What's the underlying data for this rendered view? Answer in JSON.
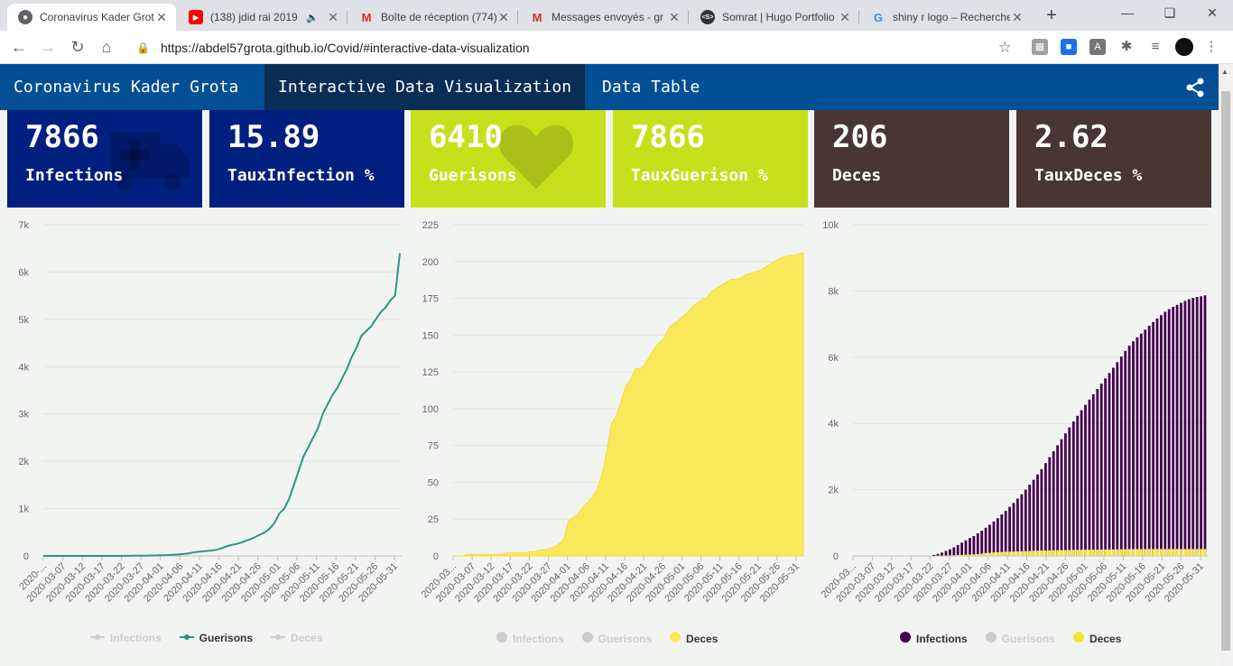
{
  "browser": {
    "tabs": [
      {
        "title": "Coronavirus Kader Grota",
        "favicon": "globe-icon",
        "active": true
      },
      {
        "title": "(138) jdid rai 2019",
        "favicon": "youtube-icon",
        "active": false,
        "audio": true
      },
      {
        "title": "Boîte de réception (774)",
        "favicon": "gmail-icon",
        "active": false
      },
      {
        "title": "Messages envoyés - gr",
        "favicon": "gmail-icon",
        "active": false
      },
      {
        "title": "Somrat | Hugo Portfolio",
        "favicon": "hugo-icon",
        "active": false
      },
      {
        "title": "shiny r logo – Recherche",
        "favicon": "google-icon",
        "active": false
      }
    ],
    "url": "https://abdel57grota.github.io/Covid/#interactive-data-visualization"
  },
  "app": {
    "brand": "Coronavirus Kader Grota",
    "nav": [
      {
        "label": "Interactive Data Visualization",
        "active": true
      },
      {
        "label": "Data Table",
        "active": false
      }
    ]
  },
  "value_boxes": [
    {
      "value": "7866",
      "label": "Infections",
      "color": "#001f7f",
      "icon": "ambulance-icon"
    },
    {
      "value": "15.89",
      "label": "TauxInfection %",
      "color": "#001f7f",
      "icon": ""
    },
    {
      "value": "6410",
      "label": "Guerisons",
      "color": "#c6e01c",
      "icon": "heart-icon"
    },
    {
      "value": "7866",
      "label": "TauxGuerison %",
      "color": "#c6e01c",
      "icon": ""
    },
    {
      "value": "206",
      "label": "Deces",
      "color": "#4a3535",
      "icon": ""
    },
    {
      "value": "2.62",
      "label": "TauxDeces %",
      "color": "#4a3535",
      "icon": ""
    }
  ],
  "colors": {
    "nav": "#024f96",
    "nav_active": "#0a2d55",
    "guerisons_line": "#2a958a",
    "deces_area": "#f9e95a",
    "infections_bar": "#44004f",
    "deces_bar": "#f5e530",
    "legend_inactive": "#cccccc"
  },
  "chart_data": [
    {
      "type": "line",
      "x_tick_labels": [
        "2020-...",
        "2020-03-07",
        "2020-03-12",
        "2020-03-17",
        "2020-03-22",
        "2020-03-27",
        "2020-04-01",
        "2020-04-06",
        "2020-04-11",
        "2020-04-16",
        "2020-04-21",
        "2020-04-26",
        "2020-05-01",
        "2020-05-06",
        "2020-05-11",
        "2020-05-16",
        "2020-05-21",
        "2020-05-26",
        "2020-05-31"
      ],
      "y_tick_labels": [
        "0",
        "1k",
        "2k",
        "3k",
        "4k",
        "5k",
        "6k",
        "7k"
      ],
      "ylim": [
        0,
        7000
      ],
      "days": 89,
      "series": [
        {
          "name": "Infections",
          "visible": false
        },
        {
          "name": "Guerisons",
          "visible": true,
          "values": [
            0,
            0,
            0,
            0,
            0,
            0,
            0,
            0,
            0,
            0,
            0,
            0,
            0,
            0,
            0,
            0,
            0,
            1,
            2,
            3,
            4,
            5,
            7,
            9,
            12,
            16,
            20,
            25,
            30,
            40,
            50,
            70,
            85,
            95,
            105,
            115,
            130,
            160,
            200,
            230,
            250,
            280,
            320,
            350,
            400,
            450,
            500,
            580,
            700,
            900,
            1000,
            1200,
            1500,
            1800,
            2100,
            2300,
            2500,
            2700,
            3000,
            3200,
            3400,
            3550,
            3750,
            3950,
            4200,
            4400,
            4650,
            4750,
            4850,
            5000,
            5150,
            5250,
            5400,
            5500,
            6400
          ]
        },
        {
          "name": "Deces",
          "visible": false
        }
      ]
    },
    {
      "type": "area",
      "x_tick_labels": [
        "2020-03...",
        "2020-03-07",
        "2020-03-12",
        "2020-03-17",
        "2020-03-22",
        "2020-03-27",
        "2020-04-01",
        "2020-04-06",
        "2020-04-11",
        "2020-04-16",
        "2020-04-21",
        "2020-04-26",
        "2020-05-01",
        "2020-05-06",
        "2020-05-11",
        "2020-05-16",
        "2020-05-21",
        "2020-05-26",
        "2020-05-31"
      ],
      "y_tick_labels": [
        "0",
        "25",
        "50",
        "75",
        "100",
        "125",
        "150",
        "175",
        "200",
        "225"
      ],
      "ylim": [
        0,
        225
      ],
      "series": [
        {
          "name": "Infections",
          "visible": false
        },
        {
          "name": "Guerisons",
          "visible": false
        },
        {
          "name": "Deces",
          "visible": true,
          "values": [
            0,
            0,
            0,
            1,
            1,
            1,
            1,
            1,
            1,
            1,
            1,
            2,
            2,
            2,
            2,
            2,
            3,
            3,
            4,
            4,
            5,
            6,
            8,
            11,
            24,
            26,
            28,
            33,
            36,
            40,
            45,
            55,
            70,
            90,
            95,
            105,
            115,
            120,
            127,
            127,
            130,
            136,
            141,
            145,
            148,
            155,
            158,
            160,
            163,
            166,
            170,
            172,
            174,
            176,
            180,
            182,
            184,
            186,
            188,
            188,
            189,
            191,
            192,
            193,
            194,
            196,
            198,
            200,
            202,
            203,
            204,
            204,
            205,
            206
          ]
        }
      ]
    },
    {
      "type": "bar",
      "x_tick_labels": [
        "2020-03...",
        "2020-03-07",
        "2020-03-12",
        "2020-03-17",
        "2020-03-22",
        "2020-03-27",
        "2020-04-01",
        "2020-04-06",
        "2020-04-11",
        "2020-04-16",
        "2020-04-21",
        "2020-04-26",
        "2020-05-01",
        "2020-05-06",
        "2020-05-11",
        "2020-05-16",
        "2020-05-21",
        "2020-05-26",
        "2020-05-31"
      ],
      "y_tick_labels": [
        "0",
        "2k",
        "4k",
        "6k",
        "8k",
        "10k"
      ],
      "ylim": [
        0,
        10000
      ],
      "series": [
        {
          "name": "Infections",
          "visible": true,
          "values": [
            0,
            0,
            0,
            0,
            0,
            0,
            0,
            0,
            0,
            0,
            0,
            0,
            0,
            0,
            0,
            0,
            0,
            0,
            0,
            0,
            30,
            60,
            100,
            150,
            200,
            260,
            330,
            400,
            470,
            540,
            600,
            680,
            760,
            850,
            940,
            1040,
            1140,
            1250,
            1360,
            1480,
            1600,
            1730,
            1860,
            2000,
            2150,
            2300,
            2460,
            2620,
            2800,
            2980,
            3160,
            3340,
            3520,
            3700,
            3880,
            4060,
            4230,
            4400,
            4560,
            4720,
            4880,
            5040,
            5200,
            5360,
            5520,
            5680,
            5850,
            6020,
            6190,
            6350,
            6480,
            6600,
            6710,
            6830,
            6950,
            7060,
            7170,
            7270,
            7370,
            7450,
            7520,
            7580,
            7640,
            7700,
            7750,
            7790,
            7820,
            7840,
            7866
          ]
        },
        {
          "name": "Guerisons",
          "visible": false
        },
        {
          "name": "Deces",
          "visible": true,
          "values": [
            0,
            0,
            0,
            0,
            0,
            0,
            0,
            0,
            0,
            0,
            0,
            0,
            0,
            0,
            0,
            0,
            0,
            0,
            0,
            0,
            3,
            5,
            8,
            11,
            15,
            20,
            26,
            30,
            35,
            40,
            45,
            55,
            70,
            90,
            95,
            105,
            115,
            120,
            127,
            127,
            130,
            136,
            141,
            145,
            148,
            155,
            158,
            160,
            163,
            166,
            170,
            172,
            174,
            176,
            180,
            182,
            184,
            186,
            188,
            188,
            189,
            191,
            192,
            193,
            194,
            196,
            198,
            200,
            202,
            203,
            204,
            204,
            205,
            206,
            206,
            206,
            206,
            206,
            206,
            206,
            206,
            206,
            206,
            206,
            206,
            206,
            206,
            206,
            206
          ]
        }
      ]
    }
  ]
}
